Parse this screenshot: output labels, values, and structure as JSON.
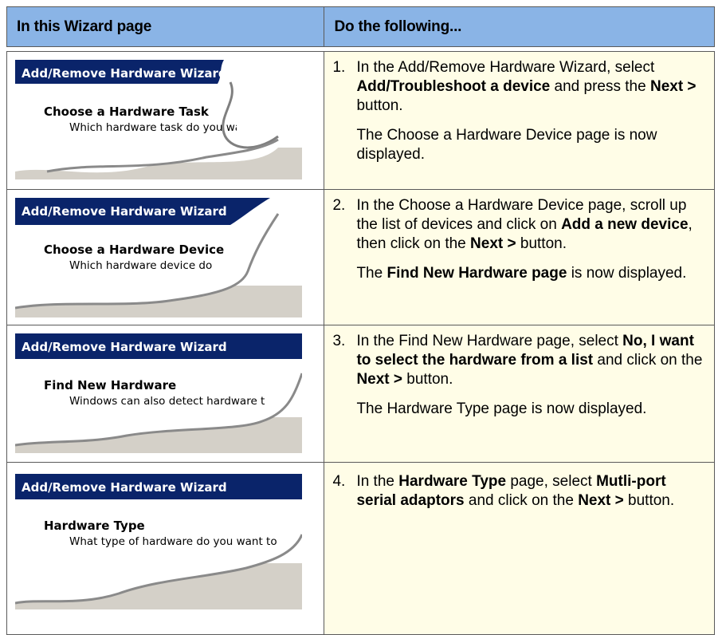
{
  "table": {
    "header_left": "In this Wizard page",
    "header_right": "Do the following...",
    "rows": [
      {
        "wizard_title": "Add/Remove Hardware Wizard",
        "page_name": "Choose a Hardware Task",
        "page_desc": "Which hardware task do you wa",
        "step_number": "1.",
        "step_t1": "In the Add/Remove Hardware Wizard, select",
        "step_b1": "Add/Troubleshoot a device",
        "step_t2": " and press the",
        "step_b2": "Next >",
        "step_t3": " button.",
        "note": "The Choose a Hardware Device page is now displayed."
      },
      {
        "wizard_title": "Add/Remove Hardware Wizard",
        "page_name": "Choose a Hardware Device",
        "page_desc": "Which hardware device do",
        "step_number": "2.",
        "step_t1": "In the Choose a Hardware Device page, scroll up the list of devices and click on",
        "step_b1": "Add a new device",
        "step_t2": ", then click on the ",
        "step_b2": "Next >",
        "step_t3": " button.",
        "note_t1": "The ",
        "note_b1": "Find New Hardware page",
        "note_t2": " is now displayed."
      },
      {
        "wizard_title": "Add/Remove Hardware Wizard",
        "page_name": "Find New Hardware",
        "page_desc": "Windows can also detect hardware t",
        "step_number": "3.",
        "step_t1": "In the Find New Hardware page, select ",
        "step_b1": "No, I want to select the hardware from a list",
        "step_t2": " and click on the ",
        "step_b2": "Next >",
        "step_t3": " button.",
        "note": "The Hardware Type page is now displayed."
      },
      {
        "wizard_title": "Add/Remove Hardware Wizard",
        "page_name": "Hardware Type",
        "page_desc": "What type of hardware do you want to",
        "step_number": "4.",
        "step_t1": "In the ",
        "step_b1": "Hardware Type",
        "step_t2": " page, select ",
        "step_b2": "Mutli-port serial adaptors",
        "step_t3": " and click on the ",
        "step_b3": "Next >",
        "step_t4": " button."
      }
    ]
  },
  "colors": {
    "header_bg": "#8ab4e6",
    "instruction_bg": "#fffde7",
    "wizard_titlebar": "#0a246a"
  }
}
